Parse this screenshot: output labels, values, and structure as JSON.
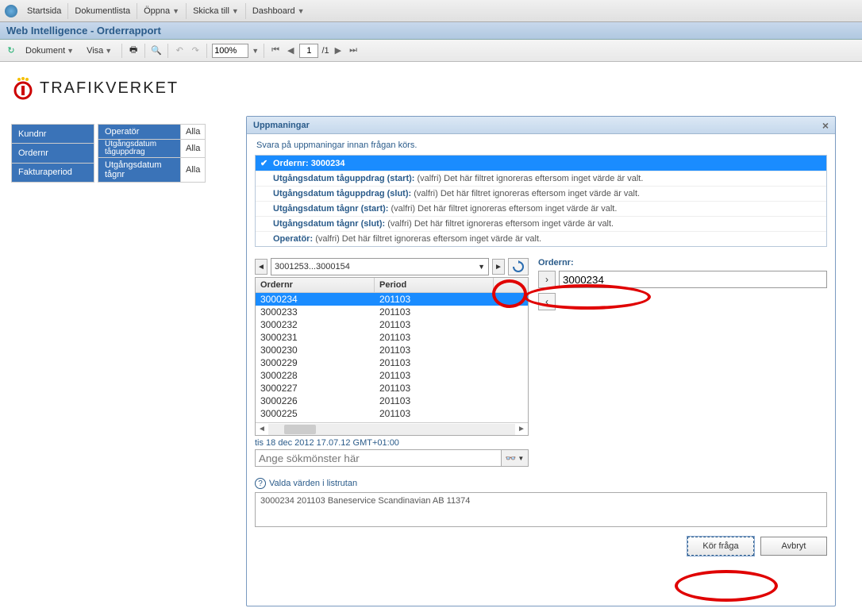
{
  "menubar": {
    "items": [
      "Startsida",
      "Dokumentlista",
      "Öppna",
      "Skicka till",
      "Dashboard"
    ],
    "has_dropdown": [
      false,
      false,
      true,
      true,
      true
    ]
  },
  "titlebar": "Web Intelligence - Orderrapport",
  "toolbar": {
    "dokument": "Dokument",
    "visa": "Visa",
    "zoom": "100%",
    "page": "1",
    "page_total": "/1"
  },
  "logo_text": "TRAFIKVERKET",
  "filter_left": [
    {
      "label": "Kundnr"
    },
    {
      "label": "Ordernr"
    },
    {
      "label": "Fakturaperiod"
    }
  ],
  "filter_right": [
    {
      "label": "Operatör",
      "val": "Alla"
    },
    {
      "label": "Utgångsdatum tåguppdrag",
      "val": "Alla",
      "small": true
    },
    {
      "label": "Utgångsdatum tågnr",
      "val": "Alla"
    }
  ],
  "dialog": {
    "title": "Uppmaningar",
    "subtitle": "Svara på uppmaningar innan frågan körs.",
    "prompts": [
      {
        "check": true,
        "selected": true,
        "label": "Ordernr:",
        "value": "3000234"
      },
      {
        "check": false,
        "selected": false,
        "label": "Utgångsdatum tåguppdrag (start):",
        "value": "(valfri) Det här filtret ignoreras eftersom inget värde är valt."
      },
      {
        "check": false,
        "selected": false,
        "label": "Utgångsdatum tåguppdrag (slut):",
        "value": "(valfri) Det här filtret ignoreras eftersom inget värde är valt."
      },
      {
        "check": false,
        "selected": false,
        "label": "Utgångsdatum tågnr (start):",
        "value": "(valfri) Det här filtret ignoreras eftersom inget värde är valt."
      },
      {
        "check": false,
        "selected": false,
        "label": "Utgångsdatum tågnr (slut):",
        "value": "(valfri) Det här filtret ignoreras eftersom inget värde är valt."
      },
      {
        "check": false,
        "selected": false,
        "label": "Operatör:",
        "value": "(valfri) Det här filtret ignoreras eftersom inget värde är valt."
      }
    ],
    "range": "3001253...3000154",
    "grid_headers": [
      "Ordernr",
      "Period"
    ],
    "grid_rows": [
      {
        "order": "3000234",
        "period": "201103",
        "selected": true
      },
      {
        "order": "3000233",
        "period": "201103"
      },
      {
        "order": "3000232",
        "period": "201103"
      },
      {
        "order": "3000231",
        "period": "201103"
      },
      {
        "order": "3000230",
        "period": "201103"
      },
      {
        "order": "3000229",
        "period": "201103"
      },
      {
        "order": "3000228",
        "period": "201103"
      },
      {
        "order": "3000227",
        "period": "201103"
      },
      {
        "order": "3000226",
        "period": "201103"
      },
      {
        "order": "3000225",
        "period": "201103"
      }
    ],
    "timestamp": "tis 18 dec 2012 17.07.12 GMT+01:00",
    "search_placeholder": "Ange sökmönster här",
    "field_label": "Ordernr:",
    "field_value": "3000234",
    "selected_label": "Valda värden i listrutan",
    "selected_value": "3000234 201103 Baneservice Scandinavian AB 11374",
    "run_btn": "Kör fråga",
    "cancel_btn": "Avbryt"
  }
}
